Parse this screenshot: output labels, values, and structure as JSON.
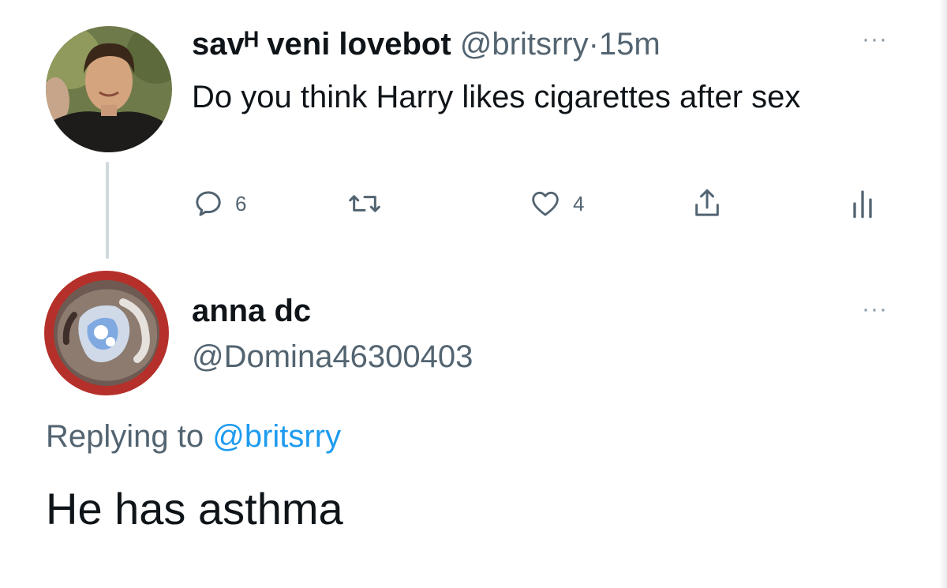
{
  "tweet": {
    "author": {
      "display_name": "savᴴ veni lovebot",
      "handle": "@britsrry"
    },
    "separator": "·",
    "time": "15m",
    "text": "Do you think Harry likes cigarettes after sex",
    "more_icon": "···",
    "actions": {
      "reply": {
        "icon": "reply-icon",
        "count": "6"
      },
      "retweet": {
        "icon": "retweet-icon"
      },
      "like": {
        "icon": "heart-icon",
        "count": "4"
      },
      "share": {
        "icon": "share-icon"
      },
      "analytics": {
        "icon": "analytics-icon"
      }
    }
  },
  "reply": {
    "author": {
      "display_name": "anna dc",
      "handle": "@Domina46300403"
    },
    "more_icon": "···",
    "replying_to": {
      "label": "Replying to",
      "mention": "@britsrry"
    },
    "text": "He has asthma"
  },
  "colors": {
    "text_primary": "#0f1419",
    "text_secondary": "#536471",
    "link": "#1d9bf0",
    "thread_line": "#cfd9de"
  }
}
